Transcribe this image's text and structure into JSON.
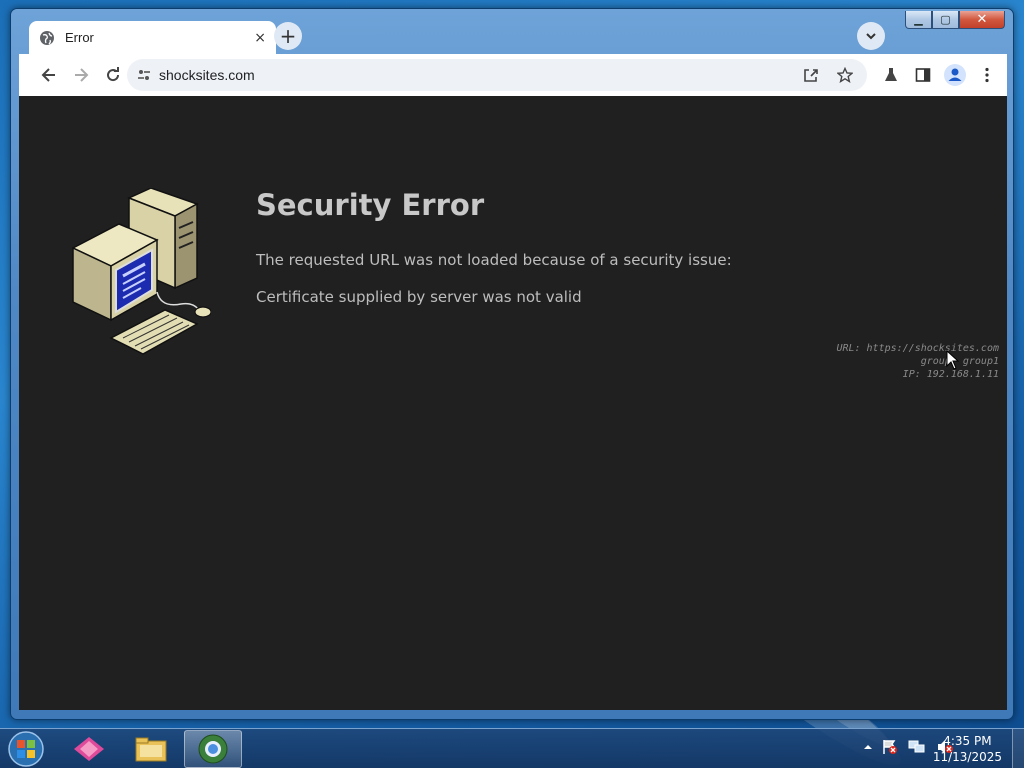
{
  "browser": {
    "tab": {
      "title": "Error",
      "close_label": "×"
    },
    "new_tab_label": "+",
    "address": {
      "url": "shocksites.com"
    }
  },
  "page": {
    "title": "Security Error",
    "message": "The requested URL was not loaded because of a security issue:",
    "reason": "Certificate supplied by server was not valid",
    "info": {
      "url_line": "URL: https://shocksites.com",
      "group_line": "group: group1",
      "ip_line": "IP: 192.168.1.11"
    }
  },
  "taskbar": {
    "clock_time": "4:35 PM",
    "clock_date": "11/13/2025"
  },
  "colors": {
    "page_bg": "#202020",
    "heading": "#c8c8c8",
    "text": "#bdbdbd",
    "monitor_screen": "#1c2bb0"
  },
  "icons": {
    "tab_favicon": "globe-icon",
    "back": "arrow-left-icon",
    "forward": "arrow-right-icon",
    "reload": "reload-icon",
    "site_info": "tune-icon",
    "share": "share-icon",
    "bookmark": "star-icon",
    "labs": "flask-icon",
    "side_panel": "side-panel-icon",
    "profile": "profile-icon",
    "menu": "kebab-menu-icon"
  }
}
